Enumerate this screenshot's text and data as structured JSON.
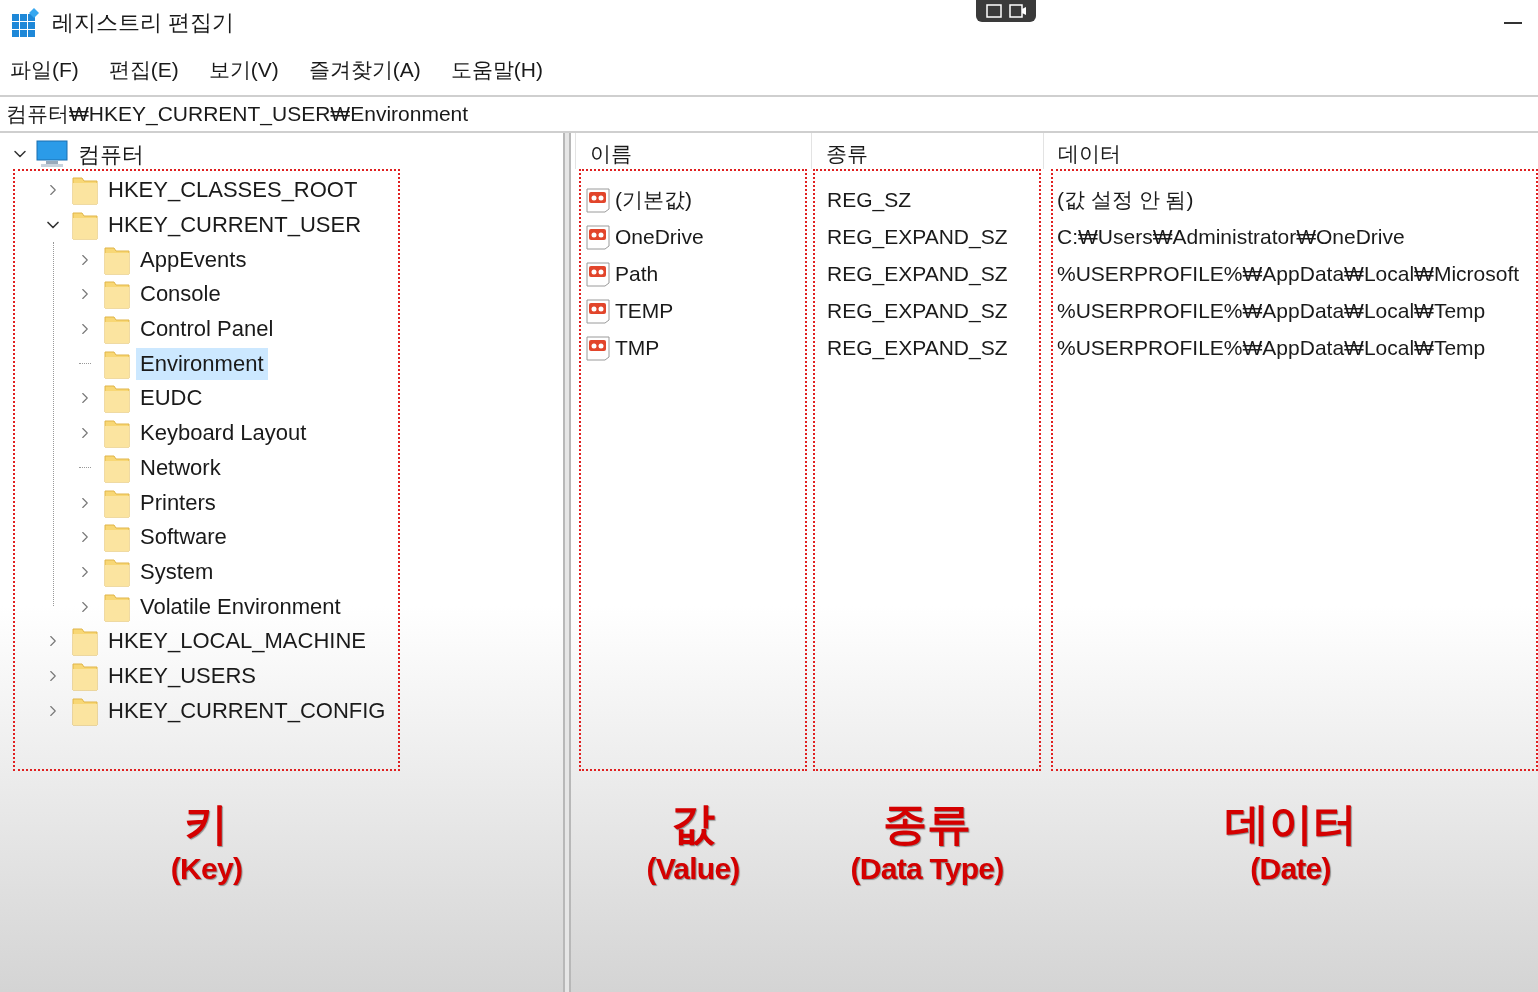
{
  "window": {
    "title": "레지스트리 편집기"
  },
  "menu": [
    "파일(F)",
    "편집(E)",
    "보기(V)",
    "즐겨찾기(A)",
    "도움말(H)"
  ],
  "address": "컴퓨터₩HKEY_CURRENT_USER₩Environment",
  "tree": {
    "label": "컴퓨터",
    "expanded": true,
    "children": [
      {
        "label": "HKEY_CLASSES_ROOT",
        "expandable": true,
        "expanded": false,
        "selected": false
      },
      {
        "label": "HKEY_CURRENT_USER",
        "expandable": true,
        "expanded": true,
        "selected": false,
        "children": [
          {
            "label": "AppEvents",
            "expandable": true,
            "expanded": false,
            "selected": false
          },
          {
            "label": "Console",
            "expandable": true,
            "expanded": false,
            "selected": false
          },
          {
            "label": "Control Panel",
            "expandable": true,
            "expanded": false,
            "selected": false
          },
          {
            "label": "Environment",
            "expandable": false,
            "selected": true
          },
          {
            "label": "EUDC",
            "expandable": true,
            "expanded": false,
            "selected": false
          },
          {
            "label": "Keyboard Layout",
            "expandable": true,
            "expanded": false,
            "selected": false
          },
          {
            "label": "Network",
            "expandable": false,
            "selected": false
          },
          {
            "label": "Printers",
            "expandable": true,
            "expanded": false,
            "selected": false
          },
          {
            "label": "Software",
            "expandable": true,
            "expanded": false,
            "selected": false
          },
          {
            "label": "System",
            "expandable": true,
            "expanded": false,
            "selected": false
          },
          {
            "label": "Volatile Environment",
            "expandable": true,
            "expanded": false,
            "selected": false
          }
        ]
      },
      {
        "label": "HKEY_LOCAL_MACHINE",
        "expandable": true,
        "expanded": false,
        "selected": false
      },
      {
        "label": "HKEY_USERS",
        "expandable": true,
        "expanded": false,
        "selected": false
      },
      {
        "label": "HKEY_CURRENT_CONFIG",
        "expandable": true,
        "expanded": false,
        "selected": false
      }
    ]
  },
  "values": {
    "columns": [
      "이름",
      "종류",
      "데이터"
    ],
    "rows": [
      {
        "name": "(기본값)",
        "type": "REG_SZ",
        "data": "(값 설정 안 됨)"
      },
      {
        "name": "OneDrive",
        "type": "REG_EXPAND_SZ",
        "data": "C:₩Users₩Administrator₩OneDrive"
      },
      {
        "name": "Path",
        "type": "REG_EXPAND_SZ",
        "data": "%USERPROFILE%₩AppData₩Local₩Microsoft"
      },
      {
        "name": "TEMP",
        "type": "REG_EXPAND_SZ",
        "data": "%USERPROFILE%₩AppData₩Local₩Temp"
      },
      {
        "name": "TMP",
        "type": "REG_EXPAND_SZ",
        "data": "%USERPROFILE%₩AppData₩Local₩Temp"
      }
    ]
  },
  "annotations": [
    {
      "title": "키",
      "subtitle": "(Key)"
    },
    {
      "title": "값",
      "subtitle": "(Value)"
    },
    {
      "title": "종류",
      "subtitle": "(Data Type)"
    },
    {
      "title": "데이터",
      "subtitle": "(Date)"
    }
  ]
}
